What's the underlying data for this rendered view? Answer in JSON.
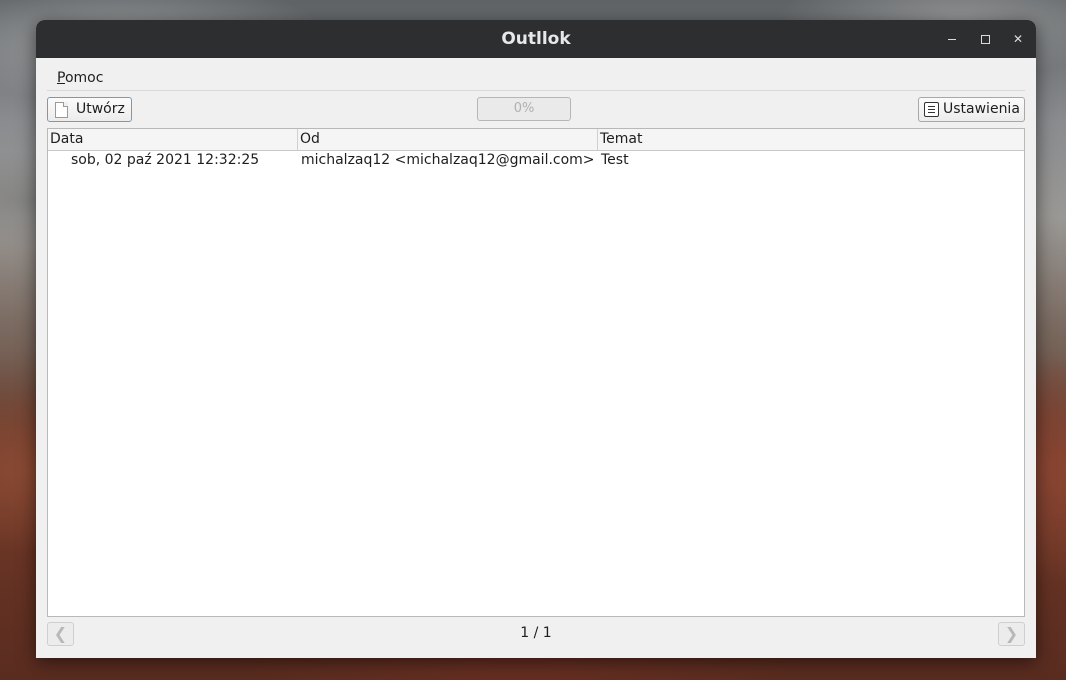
{
  "window": {
    "title": "Outllok"
  },
  "menu": {
    "items": [
      {
        "label_accel": "P",
        "label_rest": "omoc"
      }
    ]
  },
  "toolbar": {
    "create_label": "Utwórz",
    "progress_text": "0%",
    "progress_value": 0,
    "settings_label": "Ustawienia"
  },
  "table": {
    "columns": [
      "Data",
      "Od",
      "Temat"
    ],
    "rows": [
      [
        "sob, 02 paź 2021 12:32:25",
        "michalzaq12 <michalzaq12@gmail.com>",
        "Test"
      ]
    ]
  },
  "footer": {
    "page_indicator": "1 / 1",
    "prev_icon": "chevron-left-icon",
    "next_icon": "chevron-right-icon"
  },
  "colors": {
    "titlebar": "#2c2e2f",
    "accent": "#6a9ec9",
    "window_bg": "#f0f0f0"
  }
}
